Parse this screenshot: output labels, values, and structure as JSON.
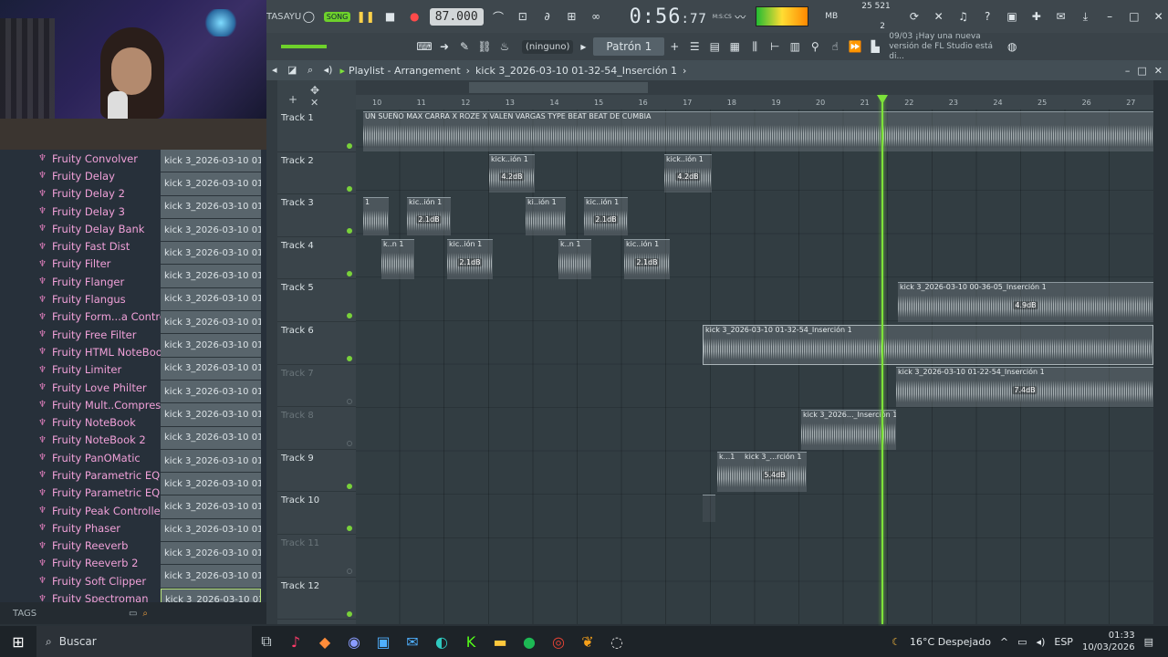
{
  "toolbar": {
    "song_label": "TASAYU",
    "song_mode": "SONG",
    "tempo": "87.000",
    "time_main": "0:56",
    "time_frac": "77",
    "time_unit": "M:S:CS",
    "cpu_value": "25",
    "ram_value": "521 MB",
    "voices": "2"
  },
  "bar2": {
    "dropdown": "(ninguno)",
    "pattern": "Patrón 1",
    "news_date": "09/03",
    "news_text": "¡Hay una nueva versión de FL Studio está di..."
  },
  "playlist": {
    "title": "Playlist - Arrangement",
    "breadcrumb": "kick 3_2026-03-10 01-32-54_Inserción 1"
  },
  "plugins": [
    "Fruity Convolver",
    "Fruity Delay",
    "Fruity Delay 2",
    "Fruity Delay 3",
    "Fruity Delay Bank",
    "Fruity Fast Dist",
    "Fruity Filter",
    "Fruity Flanger",
    "Fruity Flangus",
    "Fruity Form...a Controller",
    "Fruity Free Filter",
    "Fruity HTML NoteBook",
    "Fruity Limiter",
    "Fruity Love Philter",
    "Fruity Mult..Compressor",
    "Fruity NoteBook",
    "Fruity NoteBook 2",
    "Fruity PanOMatic",
    "Fruity Parametric EQ",
    "Fruity Parametric EQ 2",
    "Fruity Peak Controller",
    "Fruity Phaser",
    "Fruity Reeverb",
    "Fruity Reeverb 2",
    "Fruity Soft Clipper",
    "Fruity Spectroman"
  ],
  "files": [
    "kick 3_2026-03-10 01-11...",
    "kick 3_2026-03-10 01-11...",
    "kick 3_2026-03-10 01-11...",
    "kick 3_2026-03-10 01-12...",
    "kick 3_2026-03-10 01-13...",
    "kick 3_2026-03-10 01-13...",
    "kick 3_2026-03-10 01-14...",
    "kick 3_2026-03-10 01-14...",
    "kick 3_2026-03-10 01-17...",
    "kick 3_2026-03-10 01-21...",
    "kick 3_2026-03-10 01-22...",
    "kick 3_2026-03-10 01-22...",
    "kick 3_2026-03-10 01-24...",
    "kick 3_2026-03-10 01-27...",
    "kick 3_2026-03-10 01-27...",
    "kick 3_2026-03-10 01-28...",
    "kick 3_2026-03-10 01-29...",
    "kick 3_2026-03-10 01-29...",
    "kick 3_2026-03-10 01-30...",
    "kick 3_2026-03-10 01-32...",
    "kick 3_2026-03-10 01-33..."
  ],
  "tags_label": "TAGS",
  "tracks": [
    "Track 1",
    "Track 2",
    "Track 3",
    "Track 4",
    "Track 5",
    "Track 6",
    "Track 7",
    "Track 8",
    "Track 9",
    "Track 10",
    "Track 11",
    "Track 12"
  ],
  "ruler": [
    "10",
    "11",
    "12",
    "13",
    "14",
    "15",
    "16",
    "17",
    "18",
    "19",
    "20",
    "21",
    "22",
    "23",
    "24",
    "25",
    "26",
    "27"
  ],
  "clips": {
    "c1": "UN SUEÑO MAX CARRA X ROZE X VALEN VARGAS TYPE BEAT  BEAT DE CUMBIA",
    "kick_ion": "kick..ión 1",
    "kic_ion": "kic..ión 1",
    "ki_ion": "ki..ión 1",
    "kn": "k..n 1",
    "one": "1",
    "db42": "4.2dB",
    "db21": "2.1dB",
    "c5": "kick 3_2026-03-10 00-36-05_Inserción 1",
    "db49": "4.9dB",
    "c6": "kick 3_2026-03-10 01-32-54_Inserción 1",
    "c7": "kick 3_2026-03-10 01-22-54_Inserción 1",
    "db74": "7.4dB",
    "c8": "kick 3_2026..._Inserción 1",
    "c9a": "k...1",
    "c9b": "kick 3_...rción 1",
    "db54": "5.4dB"
  },
  "taskbar": {
    "search": "Buscar",
    "weather": "16°C  Despejado",
    "lang": "ESP",
    "time": "01:33",
    "date": "10/03/2026"
  }
}
